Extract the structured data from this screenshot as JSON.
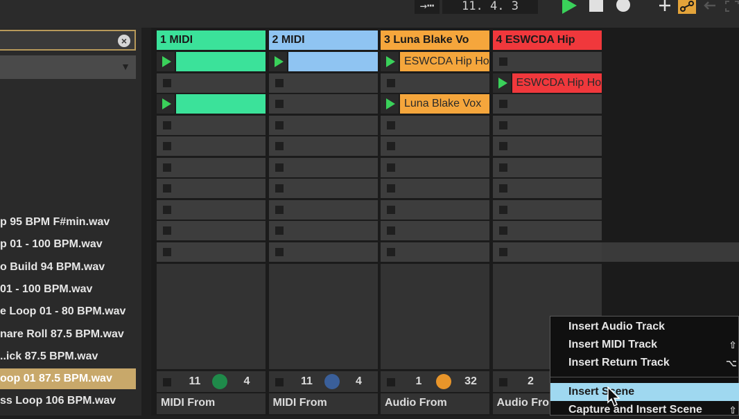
{
  "transport": {
    "position": "11.  4.  3",
    "arrow_glyph": "→┅"
  },
  "browser": {
    "search_placeholder": "",
    "files": [
      {
        "name": "p 95 BPM F#min.wav",
        "selected": false
      },
      {
        "name": "p 01 - 100 BPM.wav",
        "selected": false
      },
      {
        "name": "o Build 94 BPM.wav",
        "selected": false
      },
      {
        "name": "01 - 100 BPM.wav",
        "selected": false
      },
      {
        "name": "e Loop 01 - 80 BPM.wav",
        "selected": false
      },
      {
        "name": "nare Roll 87.5 BPM.wav",
        "selected": false
      },
      {
        "name": "..ick 87.5 BPM.wav",
        "selected": false
      },
      {
        "name": "oop 01 87.5 BPM.wav",
        "selected": true
      },
      {
        "name": "ss Loop 106 BPM.wav",
        "selected": false
      }
    ]
  },
  "tracks": [
    {
      "name": "1 MIDI",
      "color": "#3be29a",
      "clips": [
        {
          "slot": 0,
          "label": "",
          "color": "#3be29a"
        },
        {
          "slot": 2,
          "label": "",
          "color": "#3be29a"
        }
      ],
      "mixer": {
        "left": "11",
        "right": "4",
        "knob_color": "#1f8a4a"
      },
      "io": "MIDI From"
    },
    {
      "name": "2 MIDI",
      "color": "#8fc4f2",
      "clips": [
        {
          "slot": 0,
          "label": "",
          "color": "#8fc4f2"
        }
      ],
      "mixer": {
        "left": "11",
        "right": "4",
        "knob_color": "#3a5f9a"
      },
      "io": "MIDI From"
    },
    {
      "name": "3 Luna Blake Vo",
      "color": "#f5a63c",
      "clips": [
        {
          "slot": 0,
          "label": "ESWCDA Hip Ho",
          "color": "#f5a63c"
        },
        {
          "slot": 2,
          "label": "Luna Blake Vox",
          "color": "#f5a63c"
        }
      ],
      "mixer": {
        "left": "1",
        "right": "32",
        "knob_color": "#e8952a"
      },
      "io": "Audio From"
    },
    {
      "name": "4 ESWCDA Hip",
      "color": "#f0383c",
      "clips": [
        {
          "slot": 1,
          "label": "ESWCDA Hip Ho",
          "color": "#f0383c"
        }
      ],
      "mixer": {
        "left": "2",
        "right": "",
        "knob_color": ""
      },
      "io": "Audio Fro"
    }
  ],
  "context_menu": {
    "items": [
      {
        "label": "Insert Audio Track",
        "shortcut": "",
        "highlighted": false
      },
      {
        "label": "Insert MIDI Track",
        "shortcut": "⇧",
        "highlighted": false
      },
      {
        "label": "Insert Return Track",
        "shortcut": "⌥",
        "highlighted": false
      },
      {
        "label": "Insert Scene",
        "shortcut": "",
        "highlighted": true
      },
      {
        "label": "Capture and Insert Scene",
        "shortcut": "⇧",
        "highlighted": false
      }
    ]
  }
}
